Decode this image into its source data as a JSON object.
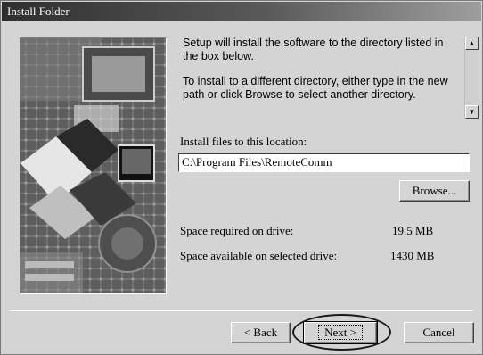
{
  "window": {
    "title": "Install Folder"
  },
  "info": {
    "line1": "Setup will install the software to the directory listed in the box below.",
    "line2": "To install to a different directory, either type in the new path or click Browse to select another directory."
  },
  "scrollbar": {
    "up_glyph": "▲",
    "down_glyph": "▼"
  },
  "install": {
    "label": "Install files to this location:",
    "path": "C:\\Program Files\\RemoteComm"
  },
  "space": {
    "required_label": "Space required on drive:",
    "required_value": "19.5 MB",
    "available_label": "Space available on selected drive:",
    "available_value": "1430 MB"
  },
  "buttons": {
    "browse": "Browse...",
    "back": "< Back",
    "next": "Next >",
    "cancel": "Cancel"
  }
}
